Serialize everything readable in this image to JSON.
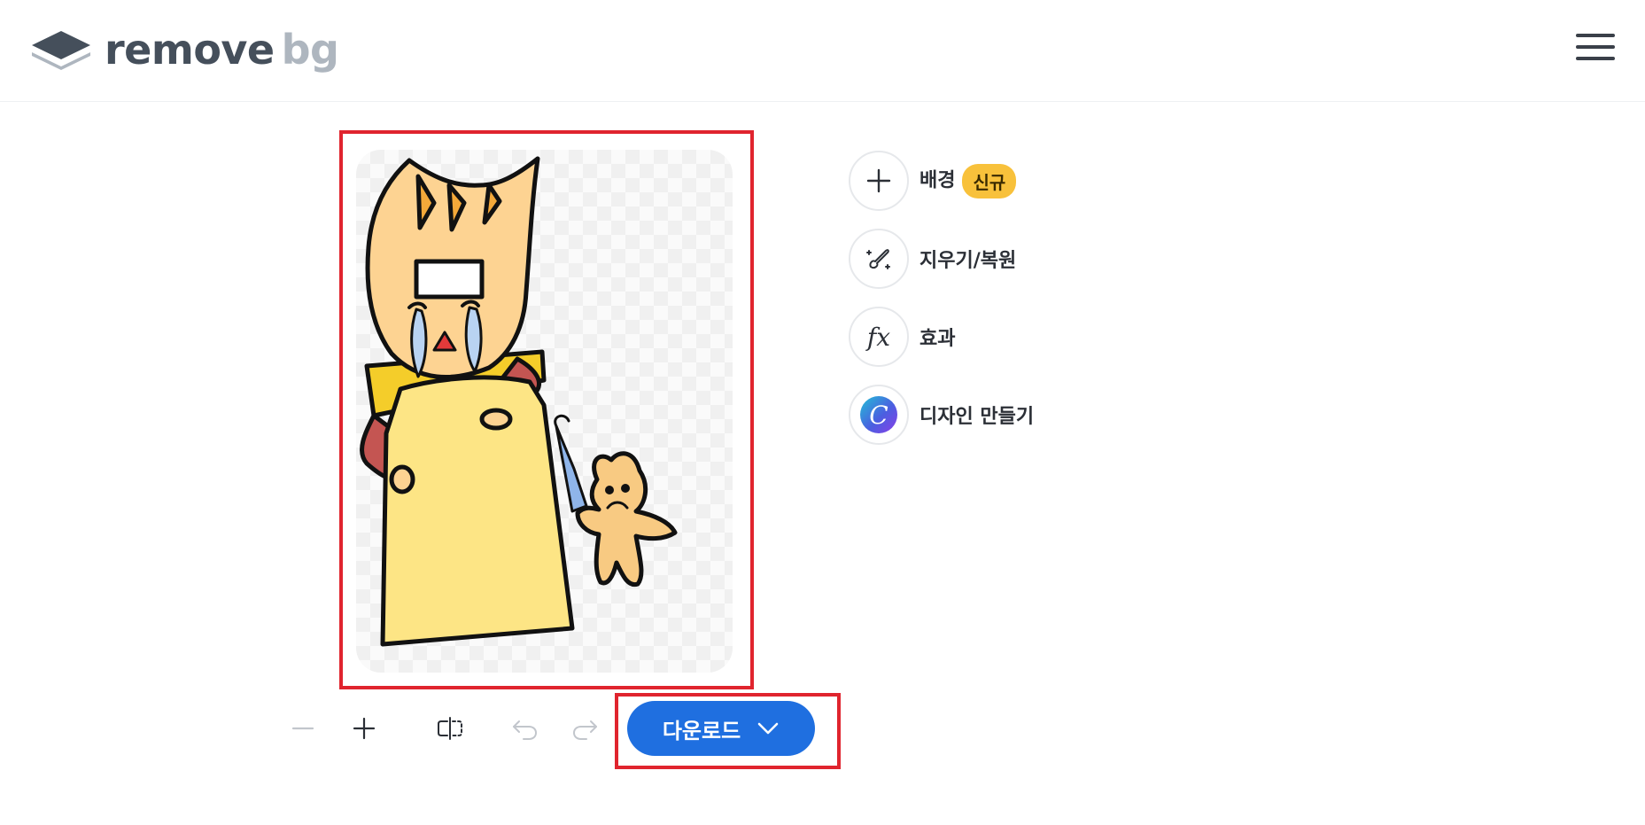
{
  "header": {
    "logo_text_1": "remove",
    "logo_text_2": "bg",
    "menu_icon": "hamburger-menu-icon"
  },
  "tools": [
    {
      "icon": "plus-icon",
      "label": "배경",
      "badge": "신규"
    },
    {
      "icon": "magic-brush-icon",
      "label": "지우기/복원"
    },
    {
      "icon": "fx-icon",
      "label": "효과",
      "icon_text": "fx"
    },
    {
      "icon": "canva-logo-icon",
      "label": "디자인 만들기",
      "icon_text": "C"
    }
  ],
  "controls": {
    "zoom_out_icon": "minus-icon",
    "zoom_in_icon": "plus-icon",
    "compare_icon": "compare-icon",
    "undo_icon": "undo-icon",
    "redo_icon": "redo-icon",
    "download_label": "다운로드",
    "download_icon": "chevron-down-icon"
  },
  "colors": {
    "accent": "#1f6fe0",
    "highlight": "#e0242e",
    "badge": "#f8c13b"
  }
}
